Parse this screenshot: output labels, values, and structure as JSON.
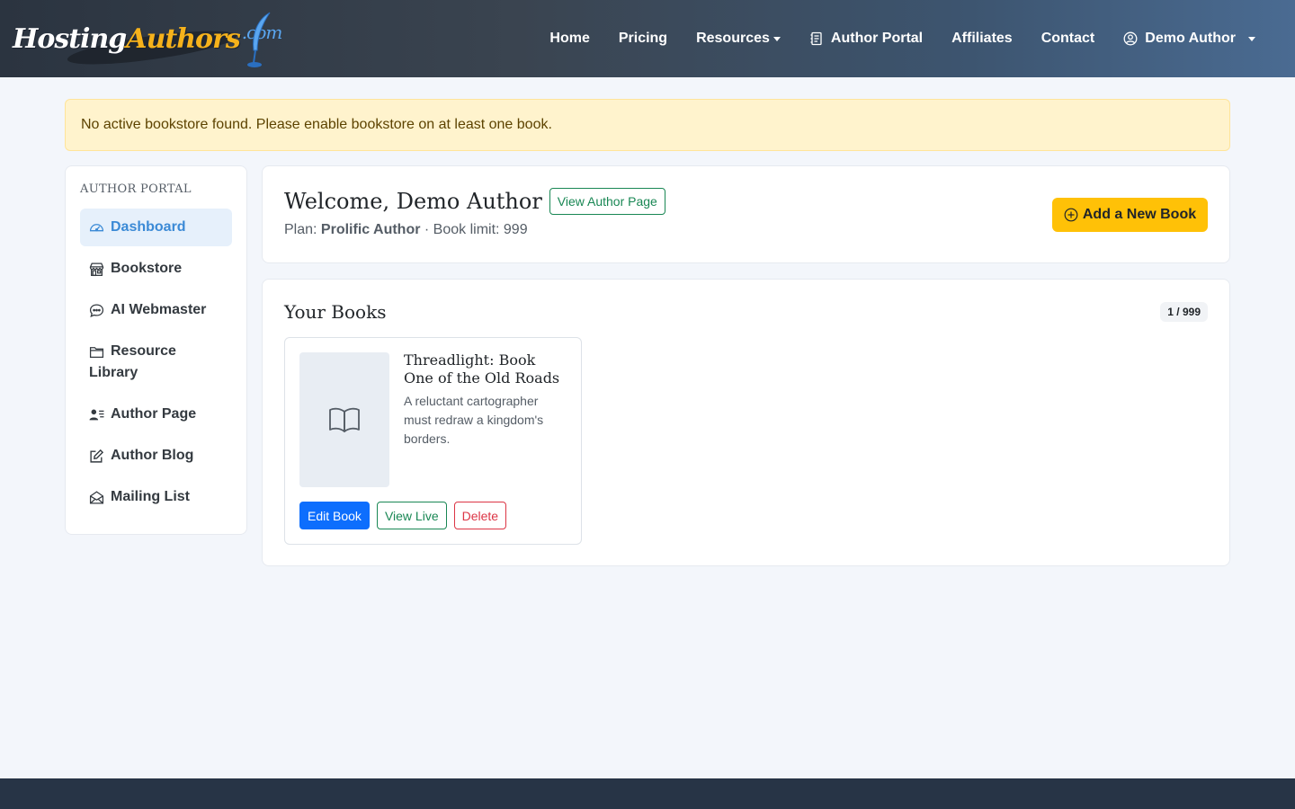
{
  "brand": {
    "part1": "Hosting",
    "part2": "Authors",
    "part3": ".com"
  },
  "nav": {
    "home": "Home",
    "pricing": "Pricing",
    "resources": "Resources",
    "author_portal": "Author Portal",
    "affiliates": "Affiliates",
    "contact": "Contact",
    "user": "Demo Author"
  },
  "alert": {
    "text": "No active bookstore found. Please enable bookstore on at least one book."
  },
  "sidebar": {
    "heading": "Author Portal",
    "items": [
      {
        "label": "Dashboard",
        "icon": "speedometer-icon",
        "active": true
      },
      {
        "label": "Bookstore",
        "icon": "shop-icon"
      },
      {
        "label": "AI Webmaster",
        "icon": "chat-icon"
      },
      {
        "label": "Resource Library",
        "icon": "folder-icon"
      },
      {
        "label": "Author Page",
        "icon": "person-lines-icon"
      },
      {
        "label": "Author Blog",
        "icon": "pencil-square-icon"
      },
      {
        "label": "Mailing List",
        "icon": "envelope-open-icon"
      }
    ]
  },
  "welcome": {
    "title": "Welcome, Demo Author",
    "view_author_page": "View Author Page",
    "plan_label": "Plan:",
    "plan_name": "Prolific Author",
    "book_limit": "· Book limit: 999",
    "add_button": "Add a New Book"
  },
  "books": {
    "title": "Your Books",
    "count": "1 / 999",
    "items": [
      {
        "title": "Threadlight: Book One of the Old Roads",
        "description": "A reluctant cartographer must redraw a kingdom's borders.",
        "edit": "Edit Book",
        "view": "View Live",
        "delete": "Delete"
      }
    ]
  },
  "colors": {
    "accent": "#3b8ad6",
    "primary": "#0d6efd",
    "warning": "#ffc107",
    "success": "#198754",
    "danger": "#dc3545",
    "footer": "#273446"
  }
}
